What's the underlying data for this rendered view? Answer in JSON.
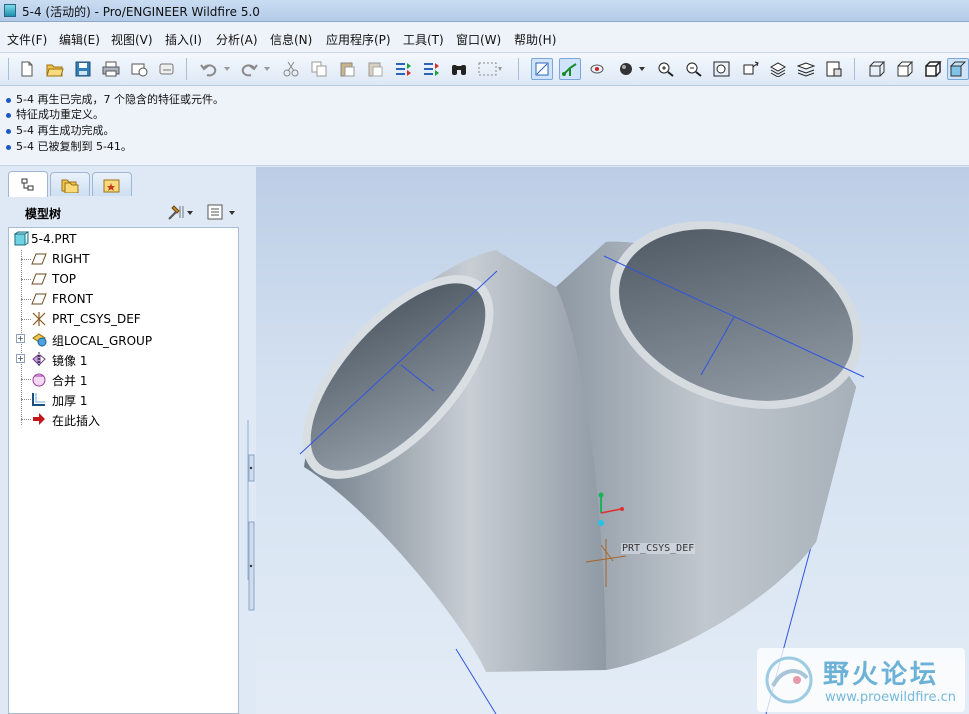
{
  "window": {
    "title": "5-4 (活动的) - Pro/ENGINEER Wildfire 5.0"
  },
  "menu": [
    {
      "label": "文件(F)"
    },
    {
      "label": "编辑(E)"
    },
    {
      "label": "视图(V)"
    },
    {
      "label": "插入(I)"
    },
    {
      "label": "分析(A)"
    },
    {
      "label": "信息(N)"
    },
    {
      "label": "应用程序(P)"
    },
    {
      "label": "工具(T)"
    },
    {
      "label": "窗口(W)"
    },
    {
      "label": "帮助(H)"
    }
  ],
  "messages": [
    "5-4 再生已完成，7 个隐含的特征或元件。",
    "特征成功重定义。",
    "5-4 再生成功完成。",
    "5-4 已被复制到 5-41。"
  ],
  "model_tree": {
    "header": "模型树",
    "items": [
      {
        "label": "5-4.PRT",
        "icon": "part-icon"
      },
      {
        "label": "RIGHT",
        "icon": "datum-plane-icon"
      },
      {
        "label": "TOP",
        "icon": "datum-plane-icon"
      },
      {
        "label": "FRONT",
        "icon": "datum-plane-icon"
      },
      {
        "label": "PRT_CSYS_DEF",
        "icon": "coordinate-system-icon"
      },
      {
        "label": "组LOCAL_GROUP",
        "icon": "group-icon"
      },
      {
        "label": "镜像 1",
        "icon": "mirror-icon"
      },
      {
        "label": "合并 1",
        "icon": "merge-icon"
      },
      {
        "label": "加厚 1",
        "icon": "thicken-icon"
      },
      {
        "label": "在此插入",
        "icon": "insert-here-arrow-icon"
      }
    ]
  },
  "viewport": {
    "csys_label": "PRT_CSYS_DEF",
    "watermark_cn": "野火论坛",
    "watermark_url": "www.proewildfire.cn"
  },
  "colors": {
    "accent": "#1b57c9",
    "datum_line": "#2f55e0"
  }
}
